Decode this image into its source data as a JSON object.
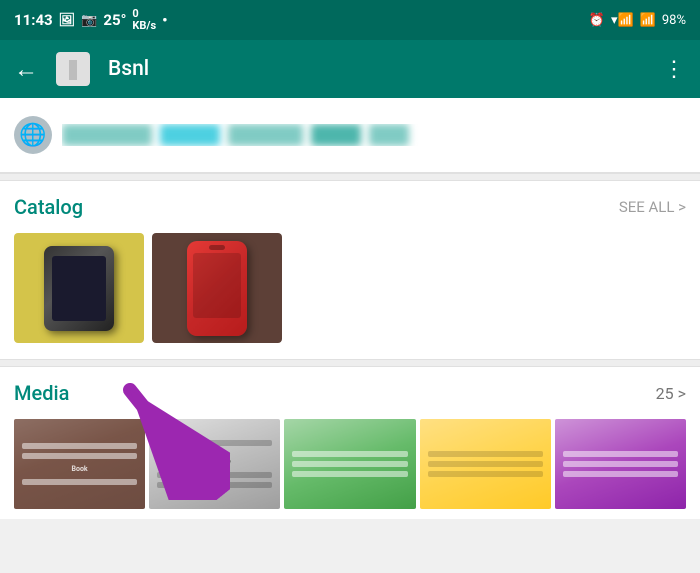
{
  "status_bar": {
    "time": "11:43",
    "temp": "25°",
    "network_speed": "0\nKB/s",
    "battery": "98%"
  },
  "app_bar": {
    "title": "Bsnl",
    "back_label": "←",
    "more_label": "⋮"
  },
  "catalog": {
    "title": "Catalog",
    "see_all": "SEE ALL >"
  },
  "media": {
    "title": "Media",
    "count": "25",
    "chevron": ">"
  }
}
